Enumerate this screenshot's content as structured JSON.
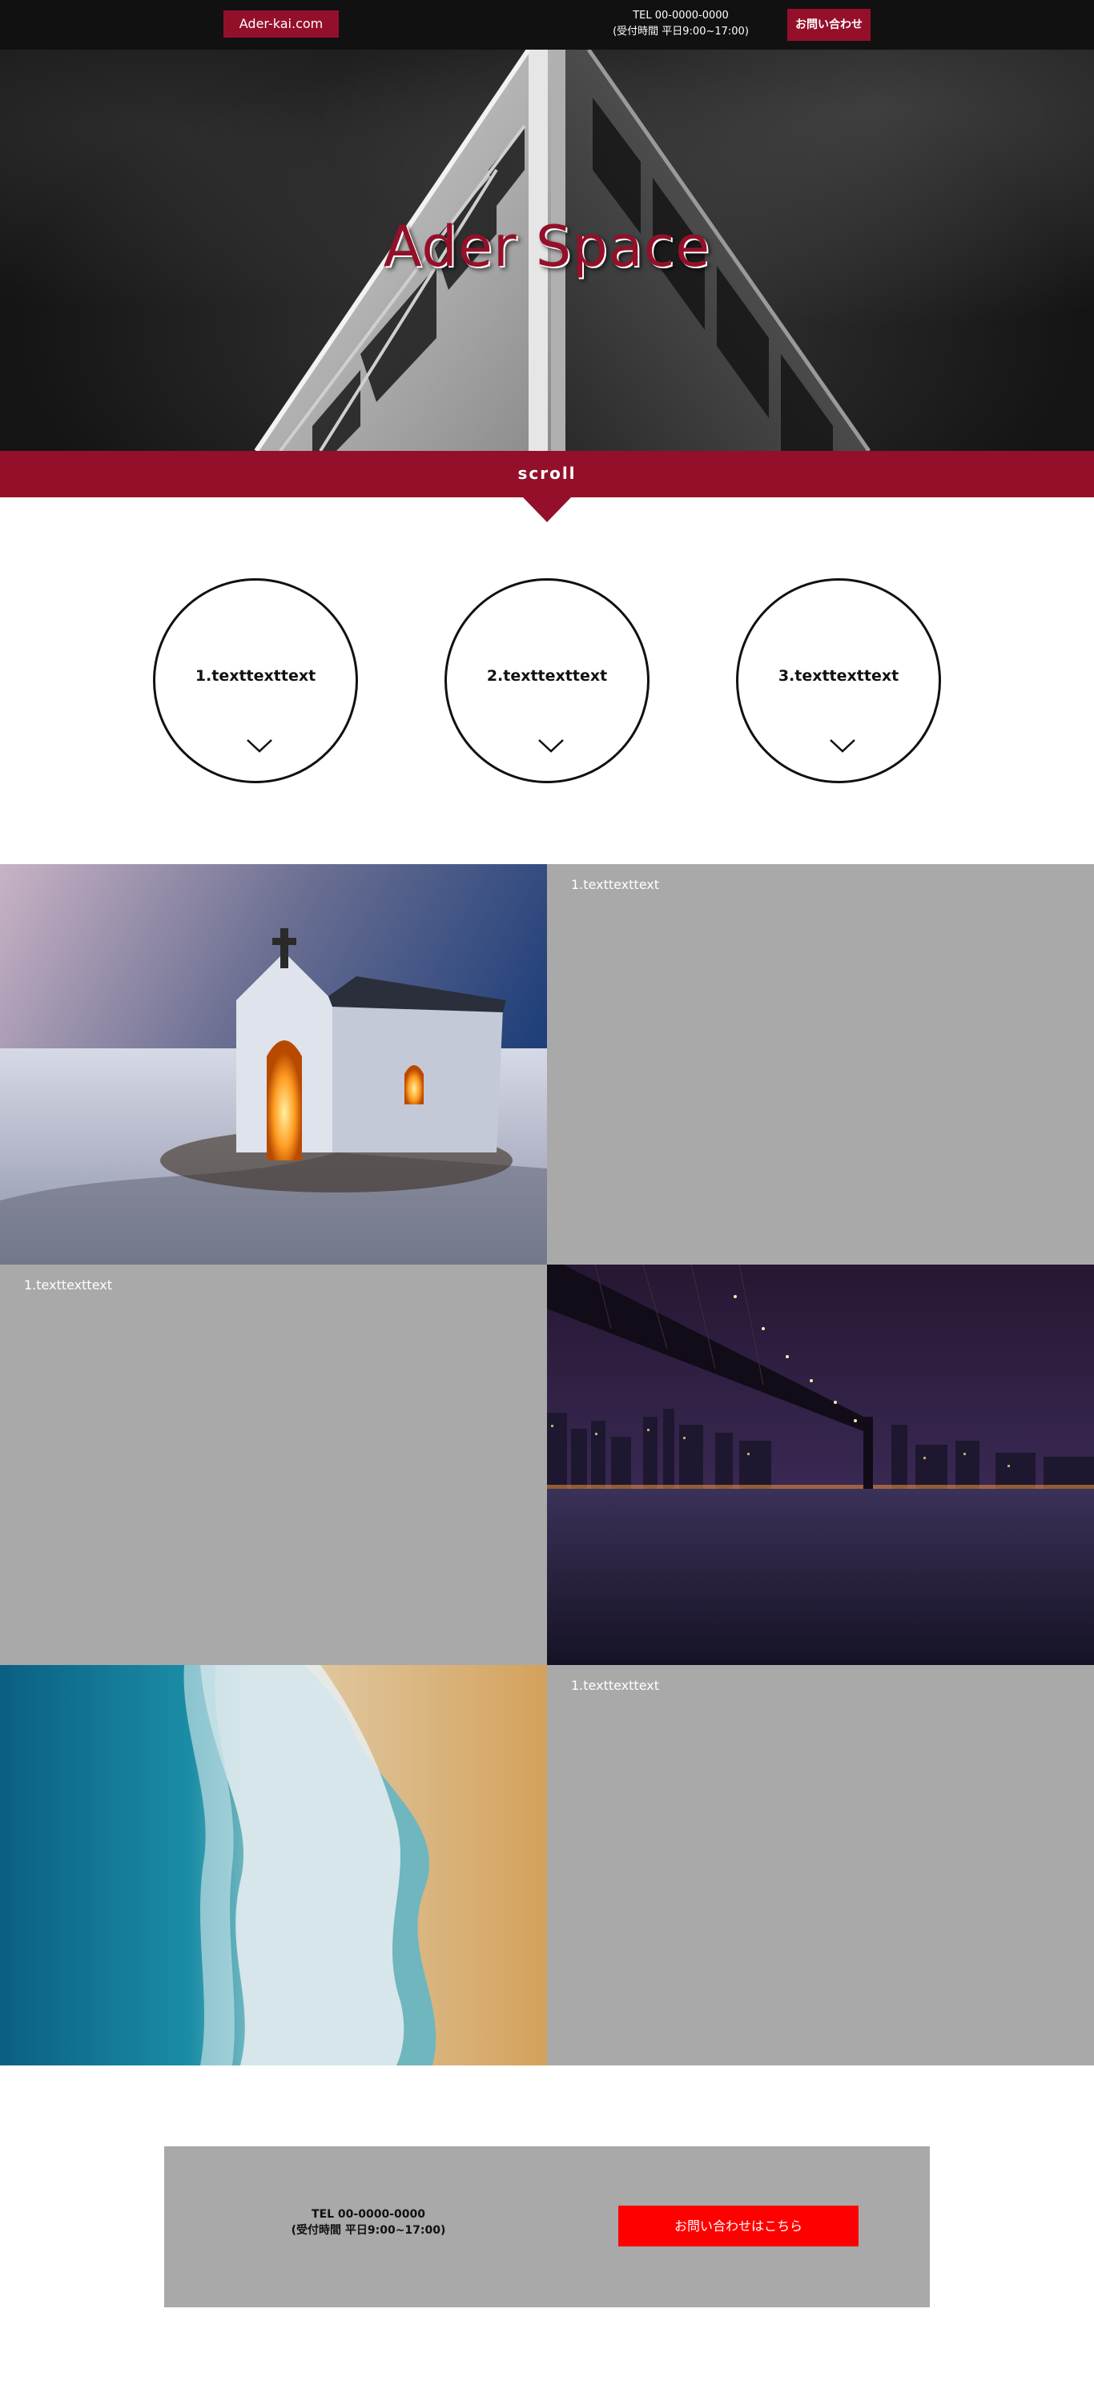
{
  "header": {
    "brand": "Ader-kai.com",
    "tel": "TEL 00-0000-0000",
    "hours": "(受付時間 平日9:00~17:00)",
    "contact_label": "お問い合わせ"
  },
  "hero": {
    "title": "Ader Space",
    "scroll_label": "scroll"
  },
  "circles": [
    {
      "label": "1.texttexttext"
    },
    {
      "label": "2.texttexttext"
    },
    {
      "label": "3.texttexttext"
    }
  ],
  "sections": [
    {
      "label": "1.texttexttext"
    },
    {
      "label": "1.texttexttext"
    },
    {
      "label": "1.texttexttext"
    }
  ],
  "cta": {
    "tel": "TEL 00-0000-0000",
    "hours": "(受付時間 平日9:00~17:00)",
    "button_label": "お問い合わせはこちら"
  },
  "colors": {
    "brand": "#94102a",
    "header_bg": "#111111",
    "panel_gray": "#a9a9a9",
    "cta_button": "#ff0000"
  }
}
